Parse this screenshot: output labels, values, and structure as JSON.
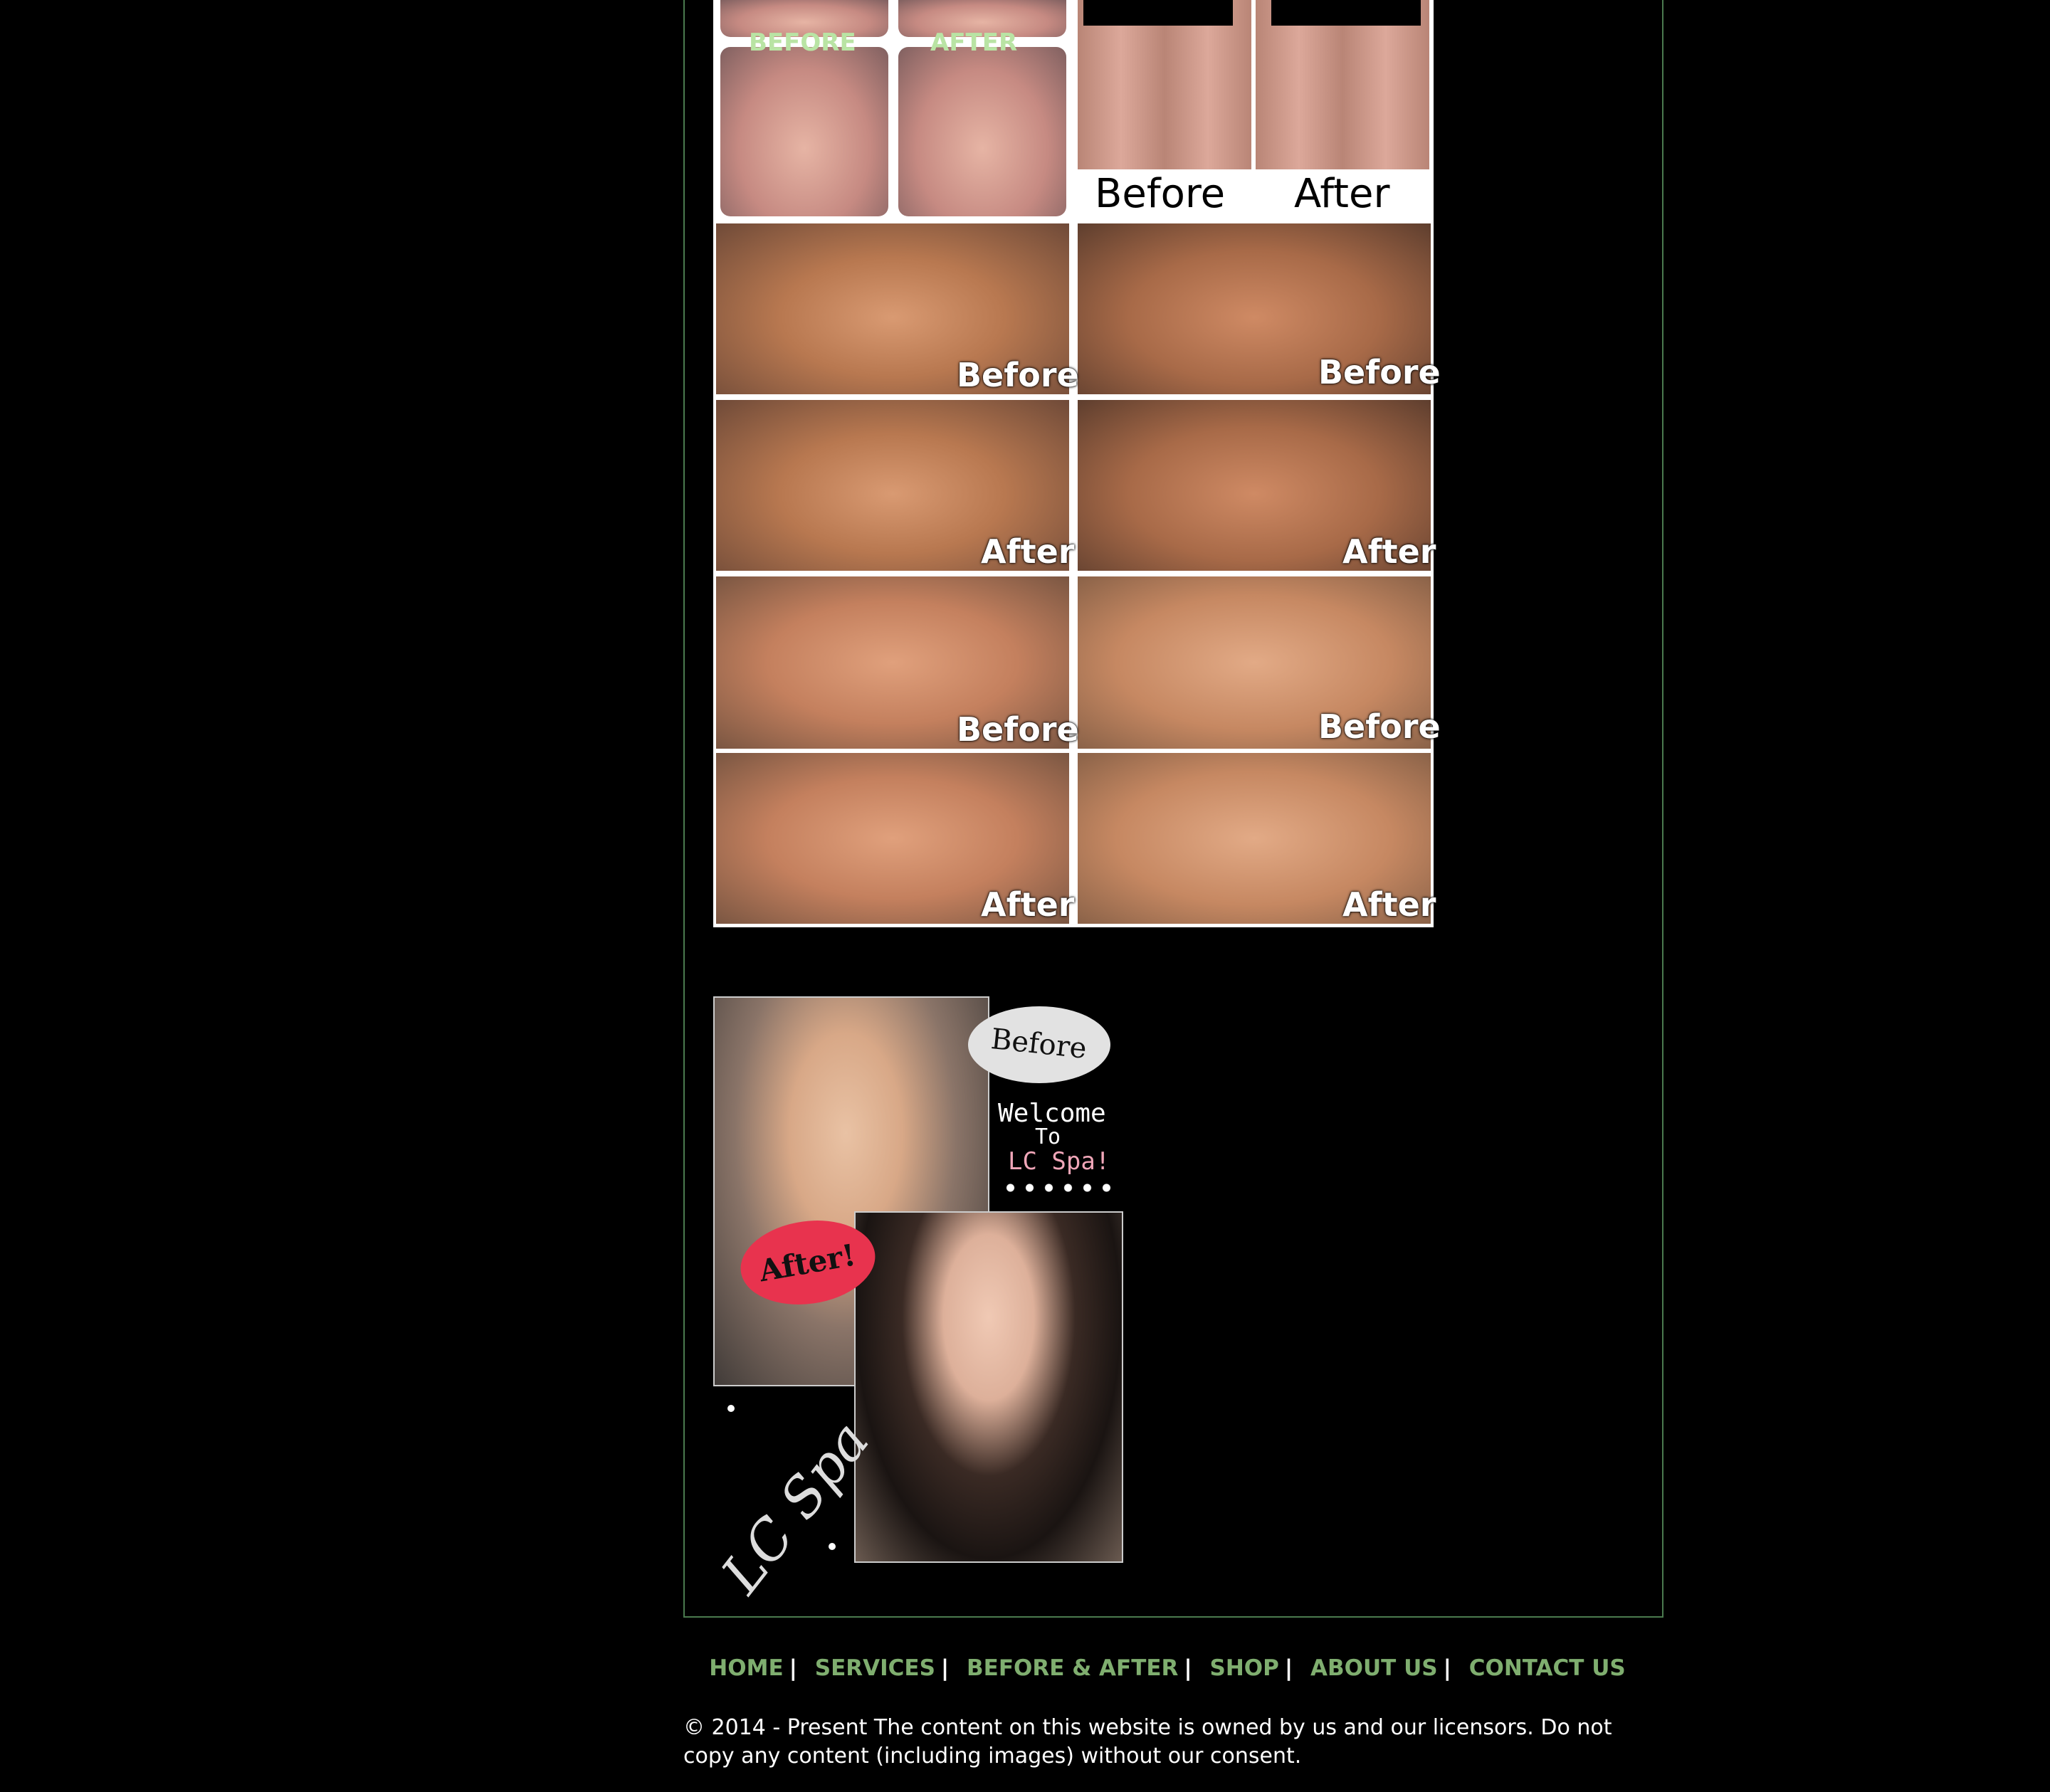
{
  "gallery": {
    "top_left_labels": [
      "BEFORE",
      "AFTER"
    ],
    "top_right_labels": [
      "Before",
      "After"
    ],
    "tile_labels": [
      "Before",
      "Before",
      "After",
      "After",
      "Before",
      "Before",
      "After",
      "After"
    ]
  },
  "facial": {
    "before_bubble": "Before",
    "welcome_line1": "Welcome",
    "welcome_line2": "To",
    "welcome_line3": "LC Spa!",
    "after_bubble": "After!",
    "logo_text": "LC Spa"
  },
  "nav": {
    "items": [
      "HOME",
      "SERVICES",
      "BEFORE & AFTER",
      "SHOP",
      "ABOUT US",
      "CONTACT US"
    ],
    "separator": "|"
  },
  "footer": {
    "copyright": "© 2014 - Present The content on this website is owned by us and our licensors. Do not copy any content (including images) without our consent."
  },
  "colors": {
    "background": "#000000",
    "nav_link": "#7fae6f",
    "border": "#4a7a4e",
    "after_bubble": "#e8334e"
  }
}
